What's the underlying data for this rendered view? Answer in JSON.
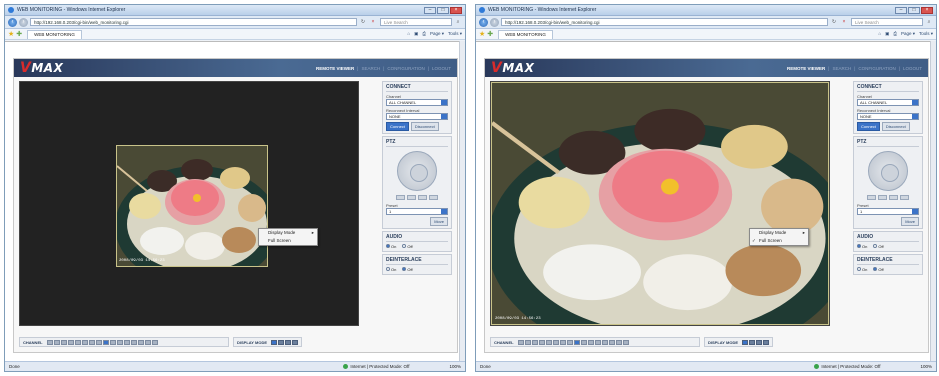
{
  "browser": {
    "title": "WEB MONITORING - Windows Internet Explorer",
    "url": "http://192.168.0.203/cgi-bin/web_monitoring.cgi",
    "search_placeholder": "Live Search",
    "tab_label": "WEB MONITORING",
    "tools": [
      "Page ▾",
      "Tools ▾"
    ],
    "status_left": "Done",
    "status_zone": "Internet | Protected Mode: Off",
    "zoom": "100%"
  },
  "app": {
    "logo_v": "V",
    "logo_rest": "MAX",
    "menu": {
      "active": "REMOTE VIEWER",
      "items": [
        "SEARCH",
        "CONFIGURATION",
        "LOGOUT"
      ]
    },
    "connect": {
      "title": "CONNECT",
      "channel_label": "Channel",
      "channel_value": "ALL CHANNEL",
      "reconnect_label": "Reconnect Interval",
      "reconnect_value": "NONE",
      "connect_btn": "Connect",
      "disconnect_btn": "Disconnect"
    },
    "ptz": {
      "title": "PTZ",
      "preset_label": "Preset",
      "preset_value": "1",
      "move_btn": "Move"
    },
    "audio": {
      "title": "AUDIO",
      "on": "On",
      "off": "Off"
    },
    "deinterlace": {
      "title": "DEINTERLACE",
      "on": "On",
      "off": "Off"
    },
    "channel_label": "CHANNEL",
    "display_mode_label": "DISPLAY MODE",
    "camera_timestamp": "2008/09/03 14:56:23"
  },
  "context_menu": {
    "display_mode": "Display Mode",
    "full_screen": "Full Screen"
  }
}
